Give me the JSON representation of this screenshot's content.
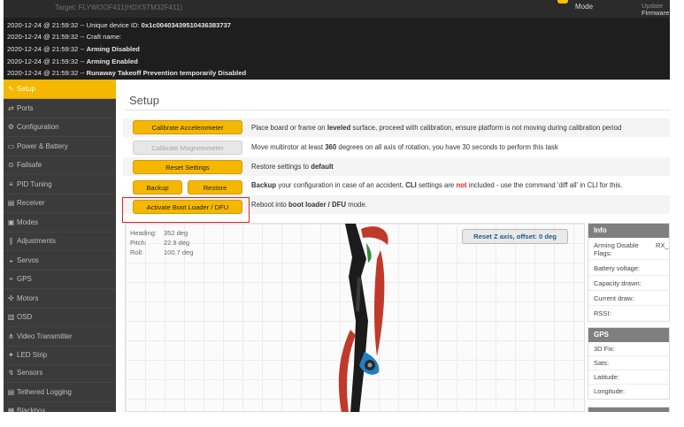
{
  "header": {
    "target": "Target: FLYWOOF411(HDXSTM32F411)",
    "mode": "Mode",
    "firmware_label": "Firmware",
    "firmware_label_top": "Update"
  },
  "log": [
    {
      "time": "2020-12-24 @ 21:59:32 -- ",
      "text": "Unique device ID: ",
      "bold": "0x1c00403439510436383737"
    },
    {
      "time": "2020-12-24 @ 21:59:32 -- ",
      "text": "Craft name: ",
      "bold": ""
    },
    {
      "time": "2020-12-24 @ 21:59:32 -- ",
      "text": "",
      "bold": "Arming Disabled"
    },
    {
      "time": "2020-12-24 @ 21:59:32 -- ",
      "text": "",
      "bold": "Arming Enabled"
    },
    {
      "time": "2020-12-24 @ 21:59:32 -- ",
      "text": "",
      "bold": "Runaway Takeoff Prevention temporarily Disabled"
    }
  ],
  "sidebar": {
    "items": [
      {
        "label": "Setup",
        "icon": "wrench-icon",
        "glyph": "✎"
      },
      {
        "label": "Ports",
        "icon": "plug-icon",
        "glyph": "⇄"
      },
      {
        "label": "Configuration",
        "icon": "gear-icon",
        "glyph": "⚙"
      },
      {
        "label": "Power & Battery",
        "icon": "battery-icon",
        "glyph": "▭"
      },
      {
        "label": "Failsafe",
        "icon": "failsafe-icon",
        "glyph": "⊙"
      },
      {
        "label": "PID Tuning",
        "icon": "sliders-icon",
        "glyph": "≡"
      },
      {
        "label": "Receiver",
        "icon": "receiver-icon",
        "glyph": "▤"
      },
      {
        "label": "Modes",
        "icon": "modes-icon",
        "glyph": "▣"
      },
      {
        "label": "Adjustments",
        "icon": "adjust-icon",
        "glyph": "∥"
      },
      {
        "label": "Servos",
        "icon": "servo-icon",
        "glyph": "◒"
      },
      {
        "label": "GPS",
        "icon": "gps-icon",
        "glyph": "⌖"
      },
      {
        "label": "Motors",
        "icon": "motor-icon",
        "glyph": "✣"
      },
      {
        "label": "OSD",
        "icon": "osd-icon",
        "glyph": "▥"
      },
      {
        "label": "Video Transmitter",
        "icon": "vtx-icon",
        "glyph": "⋔"
      },
      {
        "label": "LED Strip",
        "icon": "led-icon",
        "glyph": "✦"
      },
      {
        "label": "Sensors",
        "icon": "sensors-icon",
        "glyph": "↯"
      },
      {
        "label": "Tethered Logging",
        "icon": "log-icon",
        "glyph": "▤"
      },
      {
        "label": "Blackbox",
        "icon": "blackbox-icon",
        "glyph": "▦"
      }
    ]
  },
  "main": {
    "title": "Setup",
    "calibrate_acc_label": "Calibrate Accelerometer",
    "calibrate_acc_pre": "Place board or frame on ",
    "calibrate_acc_bold": "leveled",
    "calibrate_acc_post": " surface, proceed with calibration, ensure platform is not moving during calibration period",
    "calibrate_mag_label": "Calibrate Magnetometer",
    "calibrate_mag_pre": "Move multirotor at least ",
    "calibrate_mag_bold": "360",
    "calibrate_mag_post": " degrees on all axis of rotation, you have 30 seconds to perform this task",
    "reset_label": "Reset Settings",
    "reset_pre": "Restore settings to ",
    "reset_bold": "default",
    "backup_label": "Backup",
    "restore_label": "Restore",
    "backup_b1": "Backup",
    "backup_t1": " your configuration in case of an accident, ",
    "backup_b2": "CLI",
    "backup_t2": " settings are ",
    "backup_red": "not",
    "backup_t3": " included - use the command 'diff all' in CLI for this.",
    "dfu_label": "Activate Boot Loader / DFU",
    "dfu_pre": "Reboot into ",
    "dfu_bold": "boot loader / DFU",
    "dfu_post": " mode.",
    "reset_z_label": "Reset Z axis, offset: 0 deg",
    "attitude": {
      "heading_label": "Heading:",
      "heading_value": "352 deg",
      "pitch_label": "Pitch:",
      "pitch_value": "22.9 deg",
      "roll_label": "Roll:",
      "roll_value": "100.7 deg"
    }
  },
  "info_panel": {
    "title": "Info",
    "arming_label": "Arming Disable Flags:",
    "arming_value": "RX_F",
    "battery_label": "Battery voltage:",
    "capacity_label": "Capacity drawn:",
    "current_label": "Current draw:",
    "rssi_label": "RSSI:"
  },
  "gps_panel": {
    "title": "GPS",
    "fix_label": "3D Fix:",
    "sats_label": "Sats:",
    "latitude_label": "Latitude:",
    "longitude_label": "Longitude:"
  },
  "colors": {
    "accent": "#f5b700",
    "highlight": "#d42a2a",
    "sidebar_bg": "#3b3b3b",
    "log_bg": "#1e1e1e"
  }
}
